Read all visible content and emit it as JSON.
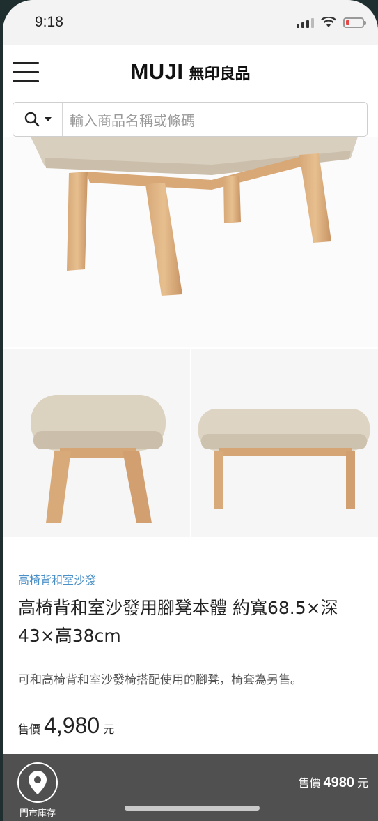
{
  "status_bar": {
    "time": "9:18"
  },
  "header": {
    "logo_en": "MUJI",
    "logo_zh": "無印良品"
  },
  "search": {
    "placeholder": "輸入商品名稱或條碼"
  },
  "product": {
    "category": "高椅背和室沙發",
    "title": "高椅背和室沙發用腳凳本體 約寬68.5×深43×高38cm",
    "description": "可和高椅背和室沙發椅搭配使用的腳凳，椅套為另售。",
    "price_label": "售價",
    "price": "4,980",
    "price_unit": "元"
  },
  "bottom_bar": {
    "store_label": "門市庫存",
    "price_label": "售價",
    "price": "4980",
    "price_unit": "元"
  },
  "colors": {
    "accent_link": "#4a90c8",
    "bottom_bar": "#505050",
    "battery_low": "#e54848"
  },
  "icons": [
    "signal-icon",
    "wifi-icon",
    "battery-icon",
    "menu-icon",
    "search-icon",
    "chevron-down-icon",
    "location-pin-icon"
  ]
}
